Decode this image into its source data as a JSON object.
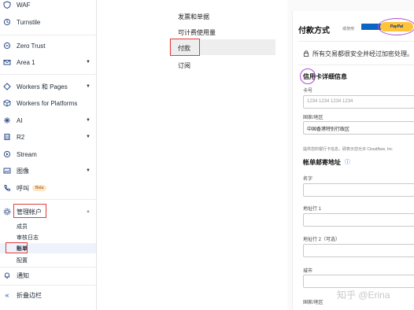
{
  "sidebar": {
    "items": [
      {
        "label": "WAF",
        "icon": "shield-icon"
      },
      {
        "label": "Turnstile",
        "icon": "turnstile-icon"
      },
      {
        "label": "Zero Trust",
        "icon": "zero-trust-icon"
      },
      {
        "label": "Area 1",
        "icon": "mail-icon"
      },
      {
        "label": "Workers 和 Pages",
        "icon": "workers-icon"
      },
      {
        "label": "Workers for Platforms",
        "icon": "cube-icon"
      },
      {
        "label": "AI",
        "icon": "ai-icon"
      },
      {
        "label": "R2",
        "icon": "storage-icon"
      },
      {
        "label": "Stream",
        "icon": "stream-icon"
      },
      {
        "label": "图像",
        "icon": "image-icon"
      },
      {
        "label": "呼叫",
        "icon": "phone-icon",
        "badge": "Beta"
      },
      {
        "label": "管理帐户",
        "icon": "gear-icon"
      },
      {
        "label": "通知",
        "icon": "bell-icon"
      },
      {
        "label": "折叠边栏",
        "icon": "collapse-icon"
      }
    ],
    "sub_items": [
      "成员",
      "审核日志",
      "账单",
      "配置"
    ]
  },
  "billing_nav": {
    "items": [
      "发票和单据",
      "可计费使用量",
      "付款",
      "订阅"
    ]
  },
  "payment": {
    "title": "付款方式",
    "or_use": "或使用",
    "paypal": "PayPal",
    "secure_note": "所有交易都很安全并经过加密处理。",
    "card_section": "信用卡详细信息",
    "card_number_label": "卡号",
    "card_number_placeholder": "1234 1234 1234 1234",
    "country_label": "国家/地区",
    "country_value": "中国香港特别行政区",
    "provider_note": "提供您的银行卡信息，即表示您允许 Cloudflare, Inc",
    "billing_section": "帐单邮寄地址",
    "name_label": "名字",
    "address1_label": "地址行 1",
    "address2_label": "地址行 2（可选）",
    "city_label": "城市",
    "country2_label": "国家/地区"
  },
  "watermark": "知乎 @Erina",
  "colors": {
    "highlight_red": "#e23b3b",
    "highlight_purple": "#b04ad6",
    "card_button_blue": "#0a66c2",
    "paypal_yellow": "#ffc439"
  }
}
